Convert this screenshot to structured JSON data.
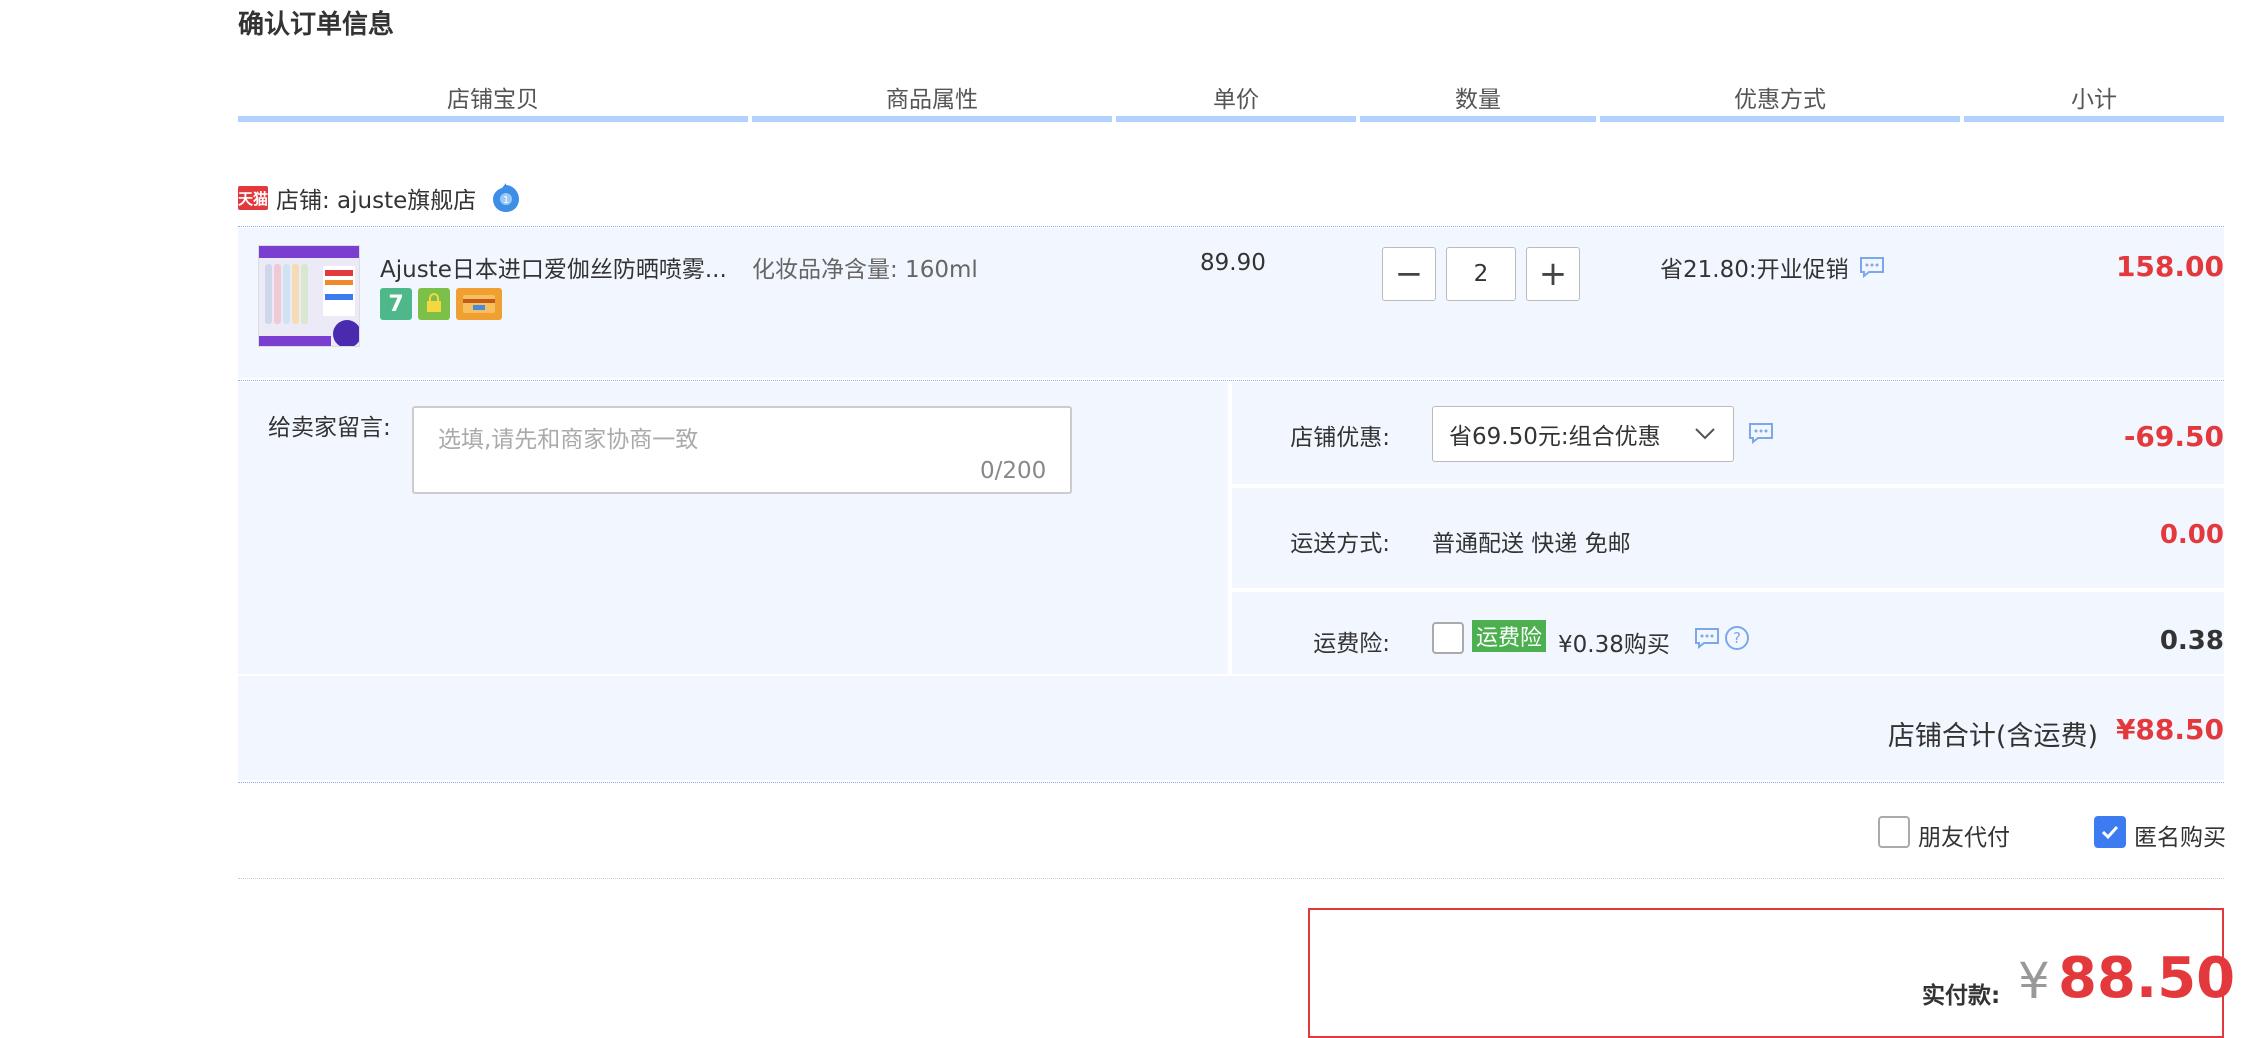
{
  "page_title": "确认订单信息",
  "columns": [
    "店铺宝贝",
    "商品属性",
    "单价",
    "数量",
    "优惠方式",
    "小计"
  ],
  "shop": {
    "badge_text": "天猫",
    "label": "店铺: ajuste旗舰店"
  },
  "item": {
    "name": "Ajuste日本进口爱伽丝防晒喷雾...",
    "attribute": "化妆品净含量: 160ml",
    "price": "89.90",
    "quantity": "2",
    "qty_minus": "−",
    "qty_plus": "+",
    "promo": "省21.80:开业促销",
    "subtotal": "158.00",
    "badges": [
      "7",
      "",
      ""
    ]
  },
  "note": {
    "label": "给卖家留言:",
    "placeholder": "选填,请先和商家协商一致",
    "counter": "0/200"
  },
  "shop_discount": {
    "label": "店铺优惠:",
    "selected": "省69.50元:组合优惠",
    "amount": "-69.50"
  },
  "shipping": {
    "label": "运送方式:",
    "method": "普通配送 快递 免邮",
    "amount": "0.00"
  },
  "insurance": {
    "label": "运费险:",
    "tag": "运费险",
    "price_text": "¥0.38购买",
    "amount": "0.38"
  },
  "shop_total": {
    "label": "店铺合计(含运费)",
    "amount": "¥88.50"
  },
  "options": {
    "friend_pay": "朋友代付",
    "anonymous": "匿名购买",
    "friend_pay_checked": false,
    "anonymous_checked": true
  },
  "final": {
    "label": "实付款:",
    "currency": "¥",
    "amount": "88.50"
  },
  "colors": {
    "accent_red": "#e4393c",
    "header_bar": "#b2d1ff",
    "row_bg": "#f2f7ff",
    "checkbox_blue": "#3d7cf0",
    "insurance_green": "#4caf50"
  },
  "icons": [
    "wangwang-icon",
    "message-icon",
    "help-icon",
    "chevron-down-icon",
    "check-icon",
    "tmall-icon"
  ]
}
